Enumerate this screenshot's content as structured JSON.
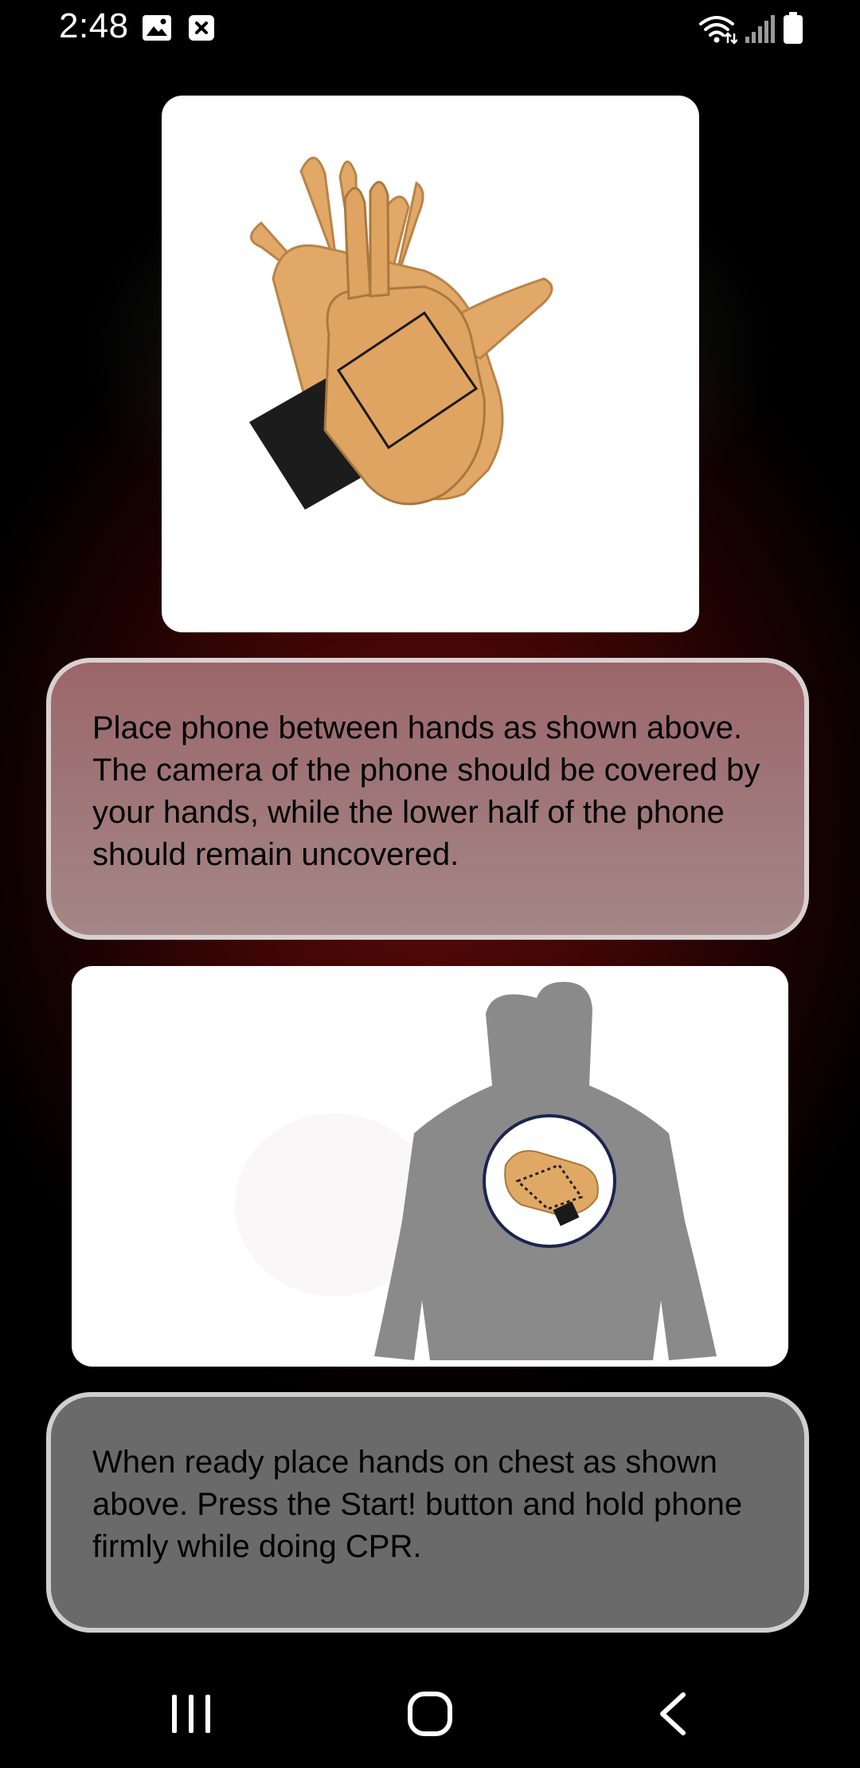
{
  "status_bar": {
    "time": "2:48",
    "icons": [
      "gallery-icon",
      "close-notification-icon",
      "wifi-icon",
      "signal-icon",
      "battery-icon"
    ]
  },
  "images": {
    "hands": "hands-with-phone-illustration",
    "chest": "hands-on-chest-illustration"
  },
  "instructions": {
    "step1": "Place phone between hands as shown above. The camera of the phone should be covered by your hands, while the lower half of the phone should remain uncovered.",
    "step2": "When ready place hands on chest as shown above. Press the Start! button and hold phone firmly while doing CPR."
  },
  "nav_bar": {
    "icons": [
      "recents-icon",
      "home-icon",
      "back-icon"
    ]
  },
  "colors": {
    "background_center": "#5e0a0a",
    "box1_fill": "#9b666a",
    "box2_fill": "#6a6a6a",
    "box_border": "#d9d0d0"
  }
}
